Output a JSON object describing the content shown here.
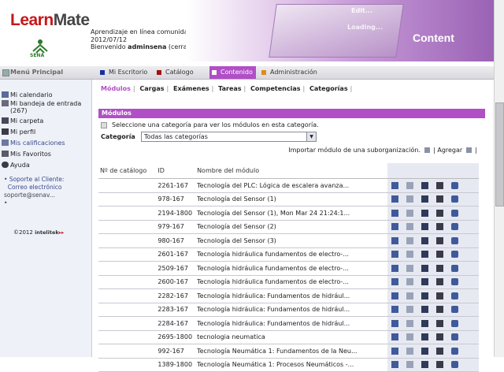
{
  "header": {
    "logo_learn": "Learn",
    "logo_mate": "Mate",
    "sena_label": "SENA",
    "info_line1": "Aprendizaje en línea comunidad",
    "info_line2": "2012/07/12",
    "info_line3_prefix": "Bienvenido",
    "info_line3_user": "adminsena",
    "info_line3_suffix": "(cerrar sesión)",
    "banner_edit": "Edit...",
    "banner_loading": "Loading...",
    "banner_content": "Content"
  },
  "navbar": {
    "menu_title": "Menú Principal",
    "tabs": [
      {
        "label": "Mi Escritorio",
        "color": "#1b2f9a"
      },
      {
        "label": "Catálogo",
        "color": "#a61010"
      },
      {
        "label": "Contenido",
        "color": "#ffffff"
      },
      {
        "label": "Administración",
        "color": "#e08a1a"
      }
    ]
  },
  "sidebar": {
    "items": [
      {
        "label": "Mi calendario"
      },
      {
        "label": "Mi bandeja de entrada (267)"
      },
      {
        "label": "Mi carpeta"
      },
      {
        "label": "Mi perfil"
      },
      {
        "label": "Mis calificaciones"
      },
      {
        "label": "Mis Favoritos"
      },
      {
        "label": "Ayuda"
      }
    ],
    "support_title": "Soporte al Cliente:",
    "support_email_label": "Correo electrónico",
    "support_email": "soporte@senav...",
    "copyright": "©2012",
    "intelitek": "intelitek"
  },
  "subnav": {
    "items": [
      "Módulos",
      "Cargas",
      "Exámenes",
      "Tareas",
      "Competencias",
      "Categorías"
    ]
  },
  "panel": {
    "title": "Módulos",
    "hint": "Seleccione una categoría para ver los módulos en esta categoría.",
    "category_label": "Categoría",
    "category_value": "Todas las categorías",
    "import_label": "Importar módulo de una suborganización.",
    "add_label": "Agregar"
  },
  "grid": {
    "headers": {
      "catalog": "Nº de catálogo",
      "id": "ID",
      "name": "Nombre del módulo"
    },
    "rows": [
      {
        "catalog": "",
        "id": "2261-167",
        "name": "Tecnología del PLC: Lógica de escalera avanza..."
      },
      {
        "catalog": "",
        "id": "978-167",
        "name": "Tecnología del Sensor (1)"
      },
      {
        "catalog": "",
        "id": "2194-1800",
        "name": "Tecnología del Sensor (1), Mon Mar 24 21:24:1..."
      },
      {
        "catalog": "",
        "id": "979-167",
        "name": "Tecnología del Sensor (2)"
      },
      {
        "catalog": "",
        "id": "980-167",
        "name": "Tecnología del Sensor (3)"
      },
      {
        "catalog": "",
        "id": "2601-167",
        "name": "Tecnología hidráulica fundamentos de electro-..."
      },
      {
        "catalog": "",
        "id": "2509-167",
        "name": "Tecnología hidráulica fundamentos de electro-..."
      },
      {
        "catalog": "",
        "id": "2600-167",
        "name": "Tecnología hidráulica fundamentos de electro-..."
      },
      {
        "catalog": "",
        "id": "2282-167",
        "name": "Tecnología hidráulica: Fundamentos de hidrául..."
      },
      {
        "catalog": "",
        "id": "2283-167",
        "name": "Tecnología hidráulica: Fundamentos de hidrául..."
      },
      {
        "catalog": "",
        "id": "2284-167",
        "name": "Tecnología hidráulica: Fundamentos de hidrául..."
      },
      {
        "catalog": "",
        "id": "2695-1800",
        "name": "tecnologia neumatica"
      },
      {
        "catalog": "",
        "id": "992-167",
        "name": "Tecnología Neumática 1: Fundamentos de la Neu..."
      },
      {
        "catalog": "",
        "id": "1389-1800",
        "name": "Tecnología Neumática 1: Procesos Neumáticos -..."
      }
    ]
  }
}
